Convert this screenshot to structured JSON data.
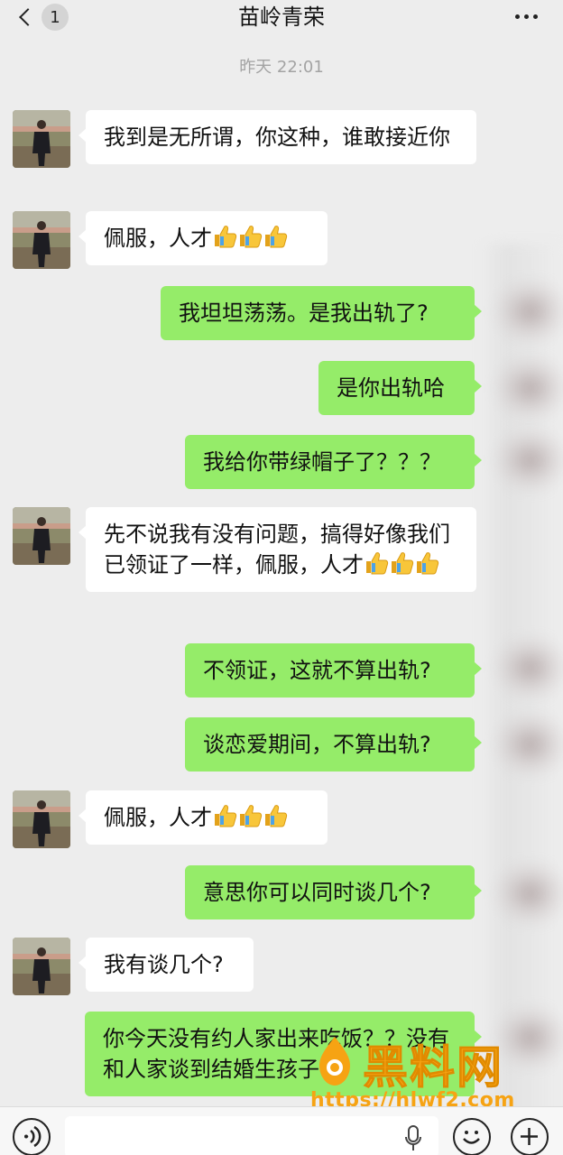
{
  "header": {
    "back_badge": "1",
    "title": "苗岭青荣",
    "more_icon": "more-dots-icon"
  },
  "timestamp": "昨天 22:01",
  "messages": [
    {
      "side": "in",
      "text": "我到是无所谓，你这种，谁敢接近你",
      "emoji_count": 0
    },
    {
      "side": "in",
      "text": "佩服，人才",
      "emoji_count": 3
    },
    {
      "side": "out",
      "text": "我坦坦荡荡。是我出轨了?",
      "emoji_count": 0
    },
    {
      "side": "out",
      "text": "是你出轨哈",
      "emoji_count": 0
    },
    {
      "side": "out",
      "text": "我给你带绿帽子了？？？",
      "emoji_count": 0
    },
    {
      "side": "in",
      "text": "先不说我有没有问题，搞得好像我们已领证了一样，佩服，人才",
      "emoji_count": 3
    },
    {
      "side": "out",
      "text": "不领证，这就不算出轨?",
      "emoji_count": 0
    },
    {
      "side": "out",
      "text": "谈恋爱期间，不算出轨?",
      "emoji_count": 0
    },
    {
      "side": "in",
      "text": "佩服，人才",
      "emoji_count": 3
    },
    {
      "side": "out",
      "text": "意思你可以同时谈几个?",
      "emoji_count": 0
    },
    {
      "side": "in",
      "text": "我有谈几个?",
      "emoji_count": 0
    },
    {
      "side": "out",
      "text": "你今天没有约人家出来吃饭？？没有和人家谈到结婚生孩子?",
      "emoji_count": 0
    }
  ],
  "watermark": {
    "title": "黑料网",
    "url": "https://hlwf2.com"
  },
  "colors": {
    "background": "#ededed",
    "incoming_bubble": "#ffffff",
    "outgoing_bubble": "#95ec69",
    "watermark": "#f6a313"
  },
  "input_bar": {
    "voice_icon": "voice-icon",
    "mic_icon": "microphone-icon",
    "emoji_icon": "emoji-icon",
    "plus_icon": "plus-icon"
  }
}
